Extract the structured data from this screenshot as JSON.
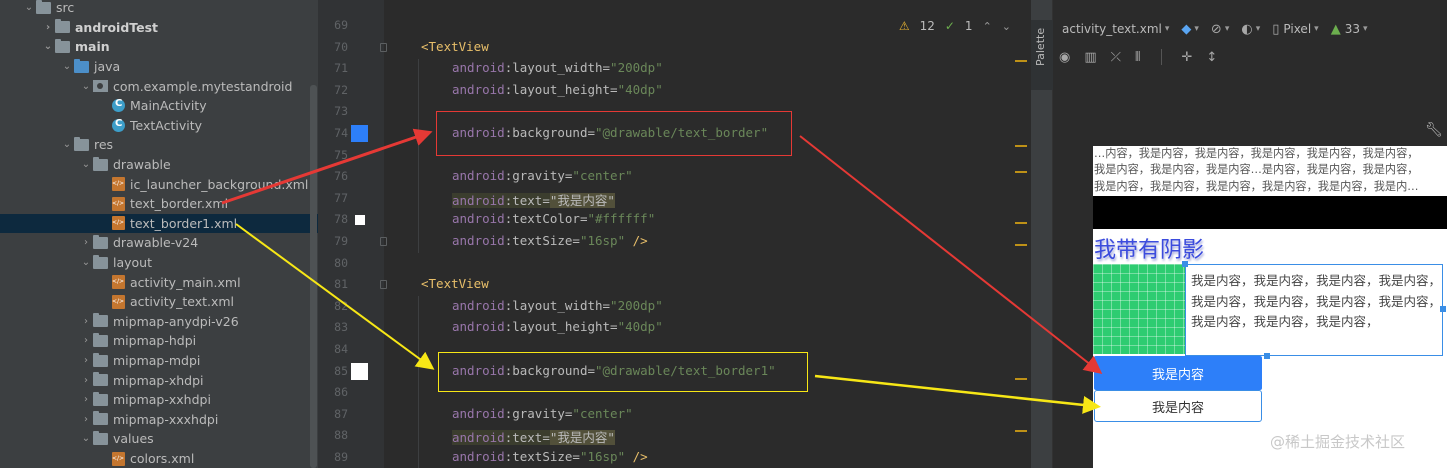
{
  "project_tree": {
    "items": [
      {
        "label": "src",
        "depth": 1,
        "chevron": "open",
        "icon": "folder",
        "bold": false
      },
      {
        "label": "androidTest",
        "depth": 2,
        "chevron": "closed",
        "icon": "folder",
        "bold": true
      },
      {
        "label": "main",
        "depth": 2,
        "chevron": "open",
        "icon": "folder",
        "bold": true
      },
      {
        "label": "java",
        "depth": 3,
        "chevron": "open",
        "icon": "folder-blue",
        "bold": false
      },
      {
        "label": "com.example.mytestandroid",
        "depth": 4,
        "chevron": "open",
        "icon": "pkg",
        "bold": false
      },
      {
        "label": "MainActivity",
        "depth": 5,
        "chevron": "none",
        "icon": "cls",
        "bold": false
      },
      {
        "label": "TextActivity",
        "depth": 5,
        "chevron": "none",
        "icon": "cls",
        "bold": false
      },
      {
        "label": "res",
        "depth": 3,
        "chevron": "open",
        "icon": "folder-res",
        "bold": false
      },
      {
        "label": "drawable",
        "depth": 4,
        "chevron": "open",
        "icon": "folder",
        "bold": false
      },
      {
        "label": "ic_launcher_background.xml",
        "depth": 5,
        "chevron": "none",
        "icon": "xml",
        "bold": false
      },
      {
        "label": "text_border.xml",
        "depth": 5,
        "chevron": "none",
        "icon": "xml",
        "bold": false
      },
      {
        "label": "text_border1.xml",
        "depth": 5,
        "chevron": "none",
        "icon": "xml",
        "bold": false,
        "selected": true
      },
      {
        "label": "drawable-v24",
        "depth": 4,
        "chevron": "closed",
        "icon": "folder",
        "bold": false
      },
      {
        "label": "layout",
        "depth": 4,
        "chevron": "open",
        "icon": "folder",
        "bold": false
      },
      {
        "label": "activity_main.xml",
        "depth": 5,
        "chevron": "none",
        "icon": "xml",
        "bold": false
      },
      {
        "label": "activity_text.xml",
        "depth": 5,
        "chevron": "none",
        "icon": "xml",
        "bold": false
      },
      {
        "label": "mipmap-anydpi-v26",
        "depth": 4,
        "chevron": "closed",
        "icon": "folder",
        "bold": false
      },
      {
        "label": "mipmap-hdpi",
        "depth": 4,
        "chevron": "closed",
        "icon": "folder",
        "bold": false
      },
      {
        "label": "mipmap-mdpi",
        "depth": 4,
        "chevron": "closed",
        "icon": "folder",
        "bold": false
      },
      {
        "label": "mipmap-xhdpi",
        "depth": 4,
        "chevron": "closed",
        "icon": "folder",
        "bold": false
      },
      {
        "label": "mipmap-xxhdpi",
        "depth": 4,
        "chevron": "closed",
        "icon": "folder",
        "bold": false
      },
      {
        "label": "mipmap-xxxhdpi",
        "depth": 4,
        "chevron": "closed",
        "icon": "folder",
        "bold": false
      },
      {
        "label": "values",
        "depth": 4,
        "chevron": "open",
        "icon": "folder",
        "bold": false
      },
      {
        "label": "colors.xml",
        "depth": 5,
        "chevron": "none",
        "icon": "xml",
        "bold": false
      }
    ]
  },
  "editor": {
    "inspections": {
      "warnings": "12",
      "weak_warnings": "1"
    },
    "lines": [
      {
        "num": "69",
        "tokens": []
      },
      {
        "num": "70",
        "tokens": [
          {
            "t": "<TextView",
            "c": "tag"
          }
        ],
        "fold": true
      },
      {
        "num": "71",
        "tokens": [
          {
            "t": "android",
            "c": "ns"
          },
          {
            "t": ":layout_width=",
            "c": "attr"
          },
          {
            "t": "\"200dp\"",
            "c": "val"
          }
        ]
      },
      {
        "num": "72",
        "tokens": [
          {
            "t": "android",
            "c": "ns"
          },
          {
            "t": ":layout_height=",
            "c": "attr"
          },
          {
            "t": "\"40dp\"",
            "c": "val"
          }
        ]
      },
      {
        "num": "73",
        "tokens": []
      },
      {
        "num": "74",
        "tokens": [
          {
            "t": "android",
            "c": "ns"
          },
          {
            "t": ":background=",
            "c": "attr"
          },
          {
            "t": "\"@drawable/text_border\"",
            "c": "val"
          }
        ],
        "swatch": "#2d7ff9"
      },
      {
        "num": "75",
        "tokens": []
      },
      {
        "num": "76",
        "tokens": [
          {
            "t": "android",
            "c": "ns"
          },
          {
            "t": ":gravity=",
            "c": "attr"
          },
          {
            "t": "\"center\"",
            "c": "val"
          }
        ]
      },
      {
        "num": "77",
        "tokens": [
          {
            "t": "android",
            "c": "hlns"
          },
          {
            "t": ":text=",
            "c": "hlattr"
          },
          {
            "t": "\"我是内容\"",
            "c": "hlval"
          }
        ]
      },
      {
        "num": "78",
        "tokens": [
          {
            "t": "android",
            "c": "ns"
          },
          {
            "t": ":textColor=",
            "c": "attr"
          },
          {
            "t": "\"#ffffff\"",
            "c": "val"
          }
        ],
        "swatch": "#ffffff"
      },
      {
        "num": "79",
        "tokens": [
          {
            "t": "android",
            "c": "ns"
          },
          {
            "t": ":textSize=",
            "c": "attr"
          },
          {
            "t": "\"16sp\"",
            "c": "val"
          },
          {
            "t": " />",
            "c": "tag"
          }
        ],
        "fold": true
      },
      {
        "num": "80",
        "tokens": []
      },
      {
        "num": "81",
        "tokens": [
          {
            "t": "<TextView",
            "c": "tag"
          }
        ],
        "fold": true
      },
      {
        "num": "82",
        "tokens": [
          {
            "t": "android",
            "c": "ns"
          },
          {
            "t": ":layout_width=",
            "c": "attr"
          },
          {
            "t": "\"200dp\"",
            "c": "val"
          }
        ]
      },
      {
        "num": "83",
        "tokens": [
          {
            "t": "android",
            "c": "ns"
          },
          {
            "t": ":layout_height=",
            "c": "attr"
          },
          {
            "t": "\"40dp\"",
            "c": "val"
          }
        ]
      },
      {
        "num": "84",
        "tokens": []
      },
      {
        "num": "85",
        "tokens": [
          {
            "t": "android",
            "c": "ns"
          },
          {
            "t": ":background=",
            "c": "attr"
          },
          {
            "t": "\"@drawable/text_border1\"",
            "c": "val"
          }
        ],
        "swatch": "#ffffff"
      },
      {
        "num": "86",
        "tokens": []
      },
      {
        "num": "87",
        "tokens": [
          {
            "t": "android",
            "c": "ns"
          },
          {
            "t": ":gravity=",
            "c": "attr"
          },
          {
            "t": "\"center\"",
            "c": "val"
          }
        ]
      },
      {
        "num": "88",
        "tokens": [
          {
            "t": "android",
            "c": "hlns"
          },
          {
            "t": ":text=",
            "c": "hlattr"
          },
          {
            "t": "\"我是内容\"",
            "c": "hlval"
          }
        ]
      },
      {
        "num": "89",
        "tokens": [
          {
            "t": "android",
            "c": "ns"
          },
          {
            "t": ":textSize=",
            "c": "attr"
          },
          {
            "t": "\"16sp\"",
            "c": "val"
          },
          {
            "t": " />",
            "c": "tag"
          }
        ]
      }
    ]
  },
  "palette_tab": "Palette",
  "design_toolbar": {
    "file": "activity_text.xml",
    "device": "Pixel",
    "api": "33"
  },
  "preview": {
    "marquee_lines": [
      "…内容，我是内容，我是内容，我是内容，我是内容，我是内容，",
      "我是内容，我是内容，我是内容…是内容，我是内容，我是内容，",
      "我是内容，我是内容，我是内容，我是内容，我是内容，我是内…"
    ],
    "shadow_text": "我带有阴影",
    "paragraph": "我是内容，我是内容，我是内容，我是内容，我是内容，我是内容，我是内容，我是内容，我是内容，我是内容，我是内容，",
    "button_blue": "我是内容",
    "button_white": "我是内容"
  },
  "watermark": "@稀土掘金技术社区",
  "colors": {
    "red_annotation": "#e53935",
    "yellow_annotation": "#f7e716",
    "blue_button": "#2d7ff9"
  }
}
